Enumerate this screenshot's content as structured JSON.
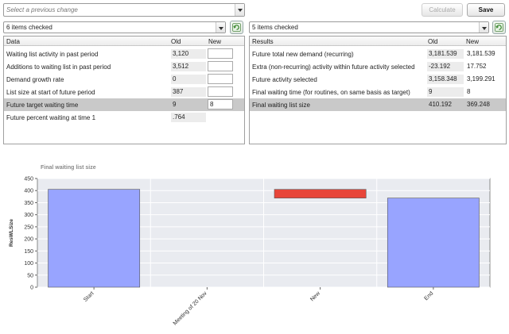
{
  "toolbar": {
    "select_placeholder": "Select a previous change",
    "calculate_label": "Calculate",
    "save_label": "Save"
  },
  "data_panel": {
    "checked_label": "6 items checked",
    "columns": {
      "name": "Data",
      "old": "Old",
      "new": "New"
    },
    "rows": [
      {
        "label": "Waiting list activity in past period",
        "old": "3,120",
        "new": ""
      },
      {
        "label": "Additions to waiting list in past period",
        "old": "3,512",
        "new": ""
      },
      {
        "label": "Demand growth rate",
        "old": "0",
        "new": ""
      },
      {
        "label": "List size at start of future period",
        "old": "387",
        "new": ""
      },
      {
        "label": "Future target waiting time",
        "old": "9",
        "new": "8"
      },
      {
        "label": "Future percent waiting at time 1",
        "old": ".764",
        "new": ""
      }
    ]
  },
  "results_panel": {
    "checked_label": "5 items checked",
    "columns": {
      "name": "Results",
      "old": "Old",
      "new": "New"
    },
    "rows": [
      {
        "label": "Future total new demand (recurring)",
        "old": "3,181.539",
        "new": "3,181.539"
      },
      {
        "label": "Extra (non-recurring) activity within future activity selected",
        "old": "-23.192",
        "new": "17.752"
      },
      {
        "label": "Future activity selected",
        "old": "3,158.348",
        "new": "3,199.291"
      },
      {
        "label": "Final waiting time (for routines, on same basis as target)",
        "old": "9",
        "new": "8"
      },
      {
        "label": "Final waiting list size",
        "old": "410.192",
        "new": "369.248"
      }
    ]
  },
  "chart_data": {
    "type": "bar",
    "title": "Final waiting list size",
    "ylabel": "ResWLSize",
    "xlabel": "",
    "categories": [
      "Start",
      "Meeting of 20 Nov",
      "New",
      "End"
    ],
    "bars": [
      {
        "category": "Start",
        "from": 0,
        "to": 405,
        "color": "#98a4ff"
      },
      {
        "category": "New",
        "from": 369,
        "to": 405,
        "color": "#e8463a"
      },
      {
        "category": "End",
        "from": 0,
        "to": 369,
        "color": "#98a4ff"
      }
    ],
    "ylim": [
      0,
      450
    ],
    "yticks": [
      0,
      50,
      100,
      150,
      200,
      250,
      300,
      350,
      400,
      450
    ],
    "grid": true
  }
}
